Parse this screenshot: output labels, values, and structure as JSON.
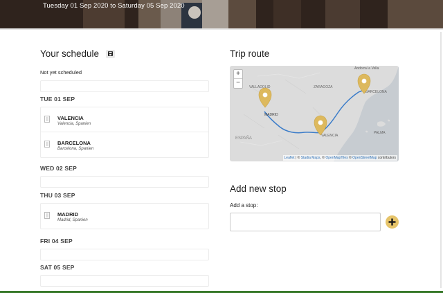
{
  "header": {
    "title": "Tuesday 01 Sep 2020 to Saturday 05 Sep 2020"
  },
  "schedule": {
    "title": "Your schedule",
    "save_icon": "save-icon",
    "unscheduled_note": "Not yet scheduled",
    "days": [
      {
        "label": "TUE 01 SEP",
        "stops": [
          {
            "city": "VALENCIA",
            "country": "Valencia, Spanien"
          },
          {
            "city": "BARCELONA",
            "country": "Barcelona, Spanien"
          }
        ]
      },
      {
        "label": "WED 02 SEP",
        "stops": []
      },
      {
        "label": "THU 03 SEP",
        "stops": [
          {
            "city": "MADRID",
            "country": "Madrid, Spanien"
          }
        ]
      },
      {
        "label": "FRI 04 SEP",
        "stops": []
      },
      {
        "label": "SAT 05 SEP",
        "stops": []
      }
    ]
  },
  "trip_route": {
    "title": "Trip route",
    "zoom_in": "+",
    "zoom_out": "−",
    "map_labels": {
      "andorra": "Andorra la Vella",
      "valladolid": "VALLADOLID",
      "zaragoza": "ZARAGOZA",
      "barcelona": "BARCELONA",
      "madrid": "MADRID",
      "valencia": "VALENCIA",
      "espana": "ESPAÑA",
      "palma": "PALMA"
    },
    "attribution": {
      "leaflet": "Leaflet",
      "sep1": " | © ",
      "stadia": "Stadia Maps",
      "sep2": ", © ",
      "omt": "OpenMapTiles",
      "sep3": " © ",
      "osm": "OpenStreetMap",
      "suffix": " contributors"
    }
  },
  "add_stop": {
    "title": "Add new stop",
    "label": "Add a stop:",
    "input_value": "",
    "placeholder": "",
    "add_icon": "plus-icon"
  },
  "colors": {
    "accent": "#e6c46a",
    "route": "#3b7cc9",
    "footer_bar": "#3a7a2c"
  }
}
